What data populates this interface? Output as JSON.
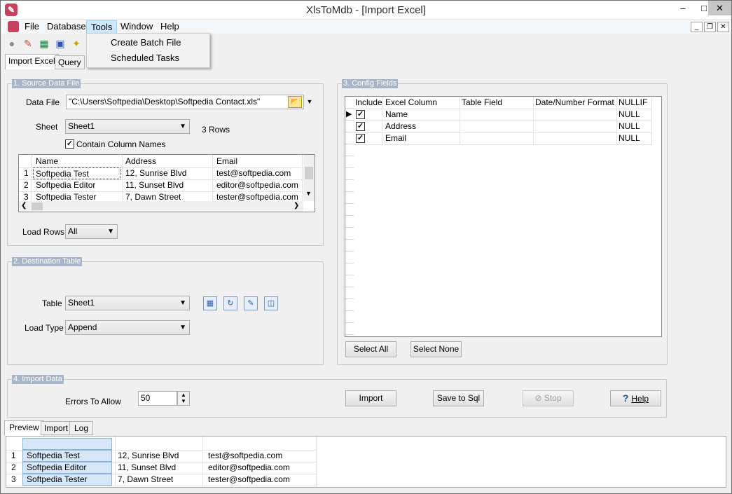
{
  "window": {
    "title": "XlsToMdb - [Import Excel]",
    "app_icon": "app-logo-icon"
  },
  "menu": {
    "file": "File",
    "database": "Database",
    "tools": "Tools",
    "window": "Window",
    "help": "Help"
  },
  "tools_menu": {
    "create_batch": "Create Batch File",
    "scheduled_tasks": "Scheduled Tasks"
  },
  "tabs": {
    "import_excel": "Import Excel",
    "query": "Query"
  },
  "source": {
    "legend": "1. Source Data File",
    "data_file_label": "Data File",
    "data_file_value": "\"C:\\Users\\Softpedia\\Desktop\\Softpedia Contact.xls\"",
    "sheet_label": "Sheet",
    "sheet_value": "Sheet1",
    "rows_text": "3 Rows",
    "contain_names_label": "Contain Column Names",
    "contain_names_checked": true,
    "columns": [
      "Name",
      "Address",
      "Email"
    ],
    "rows": [
      {
        "n": "1",
        "name": "Softpedia Test",
        "address": "12, Sunrise Blvd",
        "email": "test@softpedia.com"
      },
      {
        "n": "2",
        "name": "Softpedia Editor",
        "address": "11, Sunset Blvd",
        "email": "editor@softpedia.com"
      },
      {
        "n": "3",
        "name": "Softpedia Tester",
        "address": "7, Dawn Street",
        "email": "tester@softpedia.com"
      }
    ],
    "load_rows_label": "Load Rows",
    "load_rows_value": "All"
  },
  "destination": {
    "legend": "2. Destination Table",
    "table_label": "Table",
    "table_value": "Sheet1",
    "load_type_label": "Load Type",
    "load_type_value": "Append"
  },
  "config": {
    "legend": "3. Config Fields",
    "columns": [
      "Include",
      "Excel Column",
      "Table Field",
      "Date/Number Format",
      "NULLIF"
    ],
    "rows": [
      {
        "column": "Name",
        "field": "",
        "format": "",
        "nullif": "NULL"
      },
      {
        "column": "Address",
        "field": "",
        "format": "",
        "nullif": "NULL"
      },
      {
        "column": "Email",
        "field": "",
        "format": "",
        "nullif": "NULL"
      }
    ],
    "select_all": "Select All",
    "select_none": "Select None"
  },
  "import": {
    "legend": "4. Import Data",
    "errors_label": "Errors To Allow",
    "errors_value": "50",
    "import_btn": "Import",
    "save_sql_btn": "Save to Sql",
    "stop_btn": "Stop",
    "help_btn": "Help"
  },
  "bottom_tabs": {
    "preview": "Preview",
    "import": "Import",
    "log": "Log"
  },
  "preview_rows": [
    {
      "n": "1",
      "name": "Softpedia Test",
      "address": "12, Sunrise Blvd",
      "email": "test@softpedia.com"
    },
    {
      "n": "2",
      "name": "Softpedia Editor",
      "address": "11, Sunset Blvd",
      "email": "editor@softpedia.com"
    },
    {
      "n": "3",
      "name": "Softpedia Tester",
      "address": "7, Dawn Street",
      "email": "tester@softpedia.com"
    }
  ],
  "colors": {
    "legend_bg": "#a8b4c8",
    "menu_active": "#cce8ff",
    "selected_cell": "#d6e8f8"
  }
}
